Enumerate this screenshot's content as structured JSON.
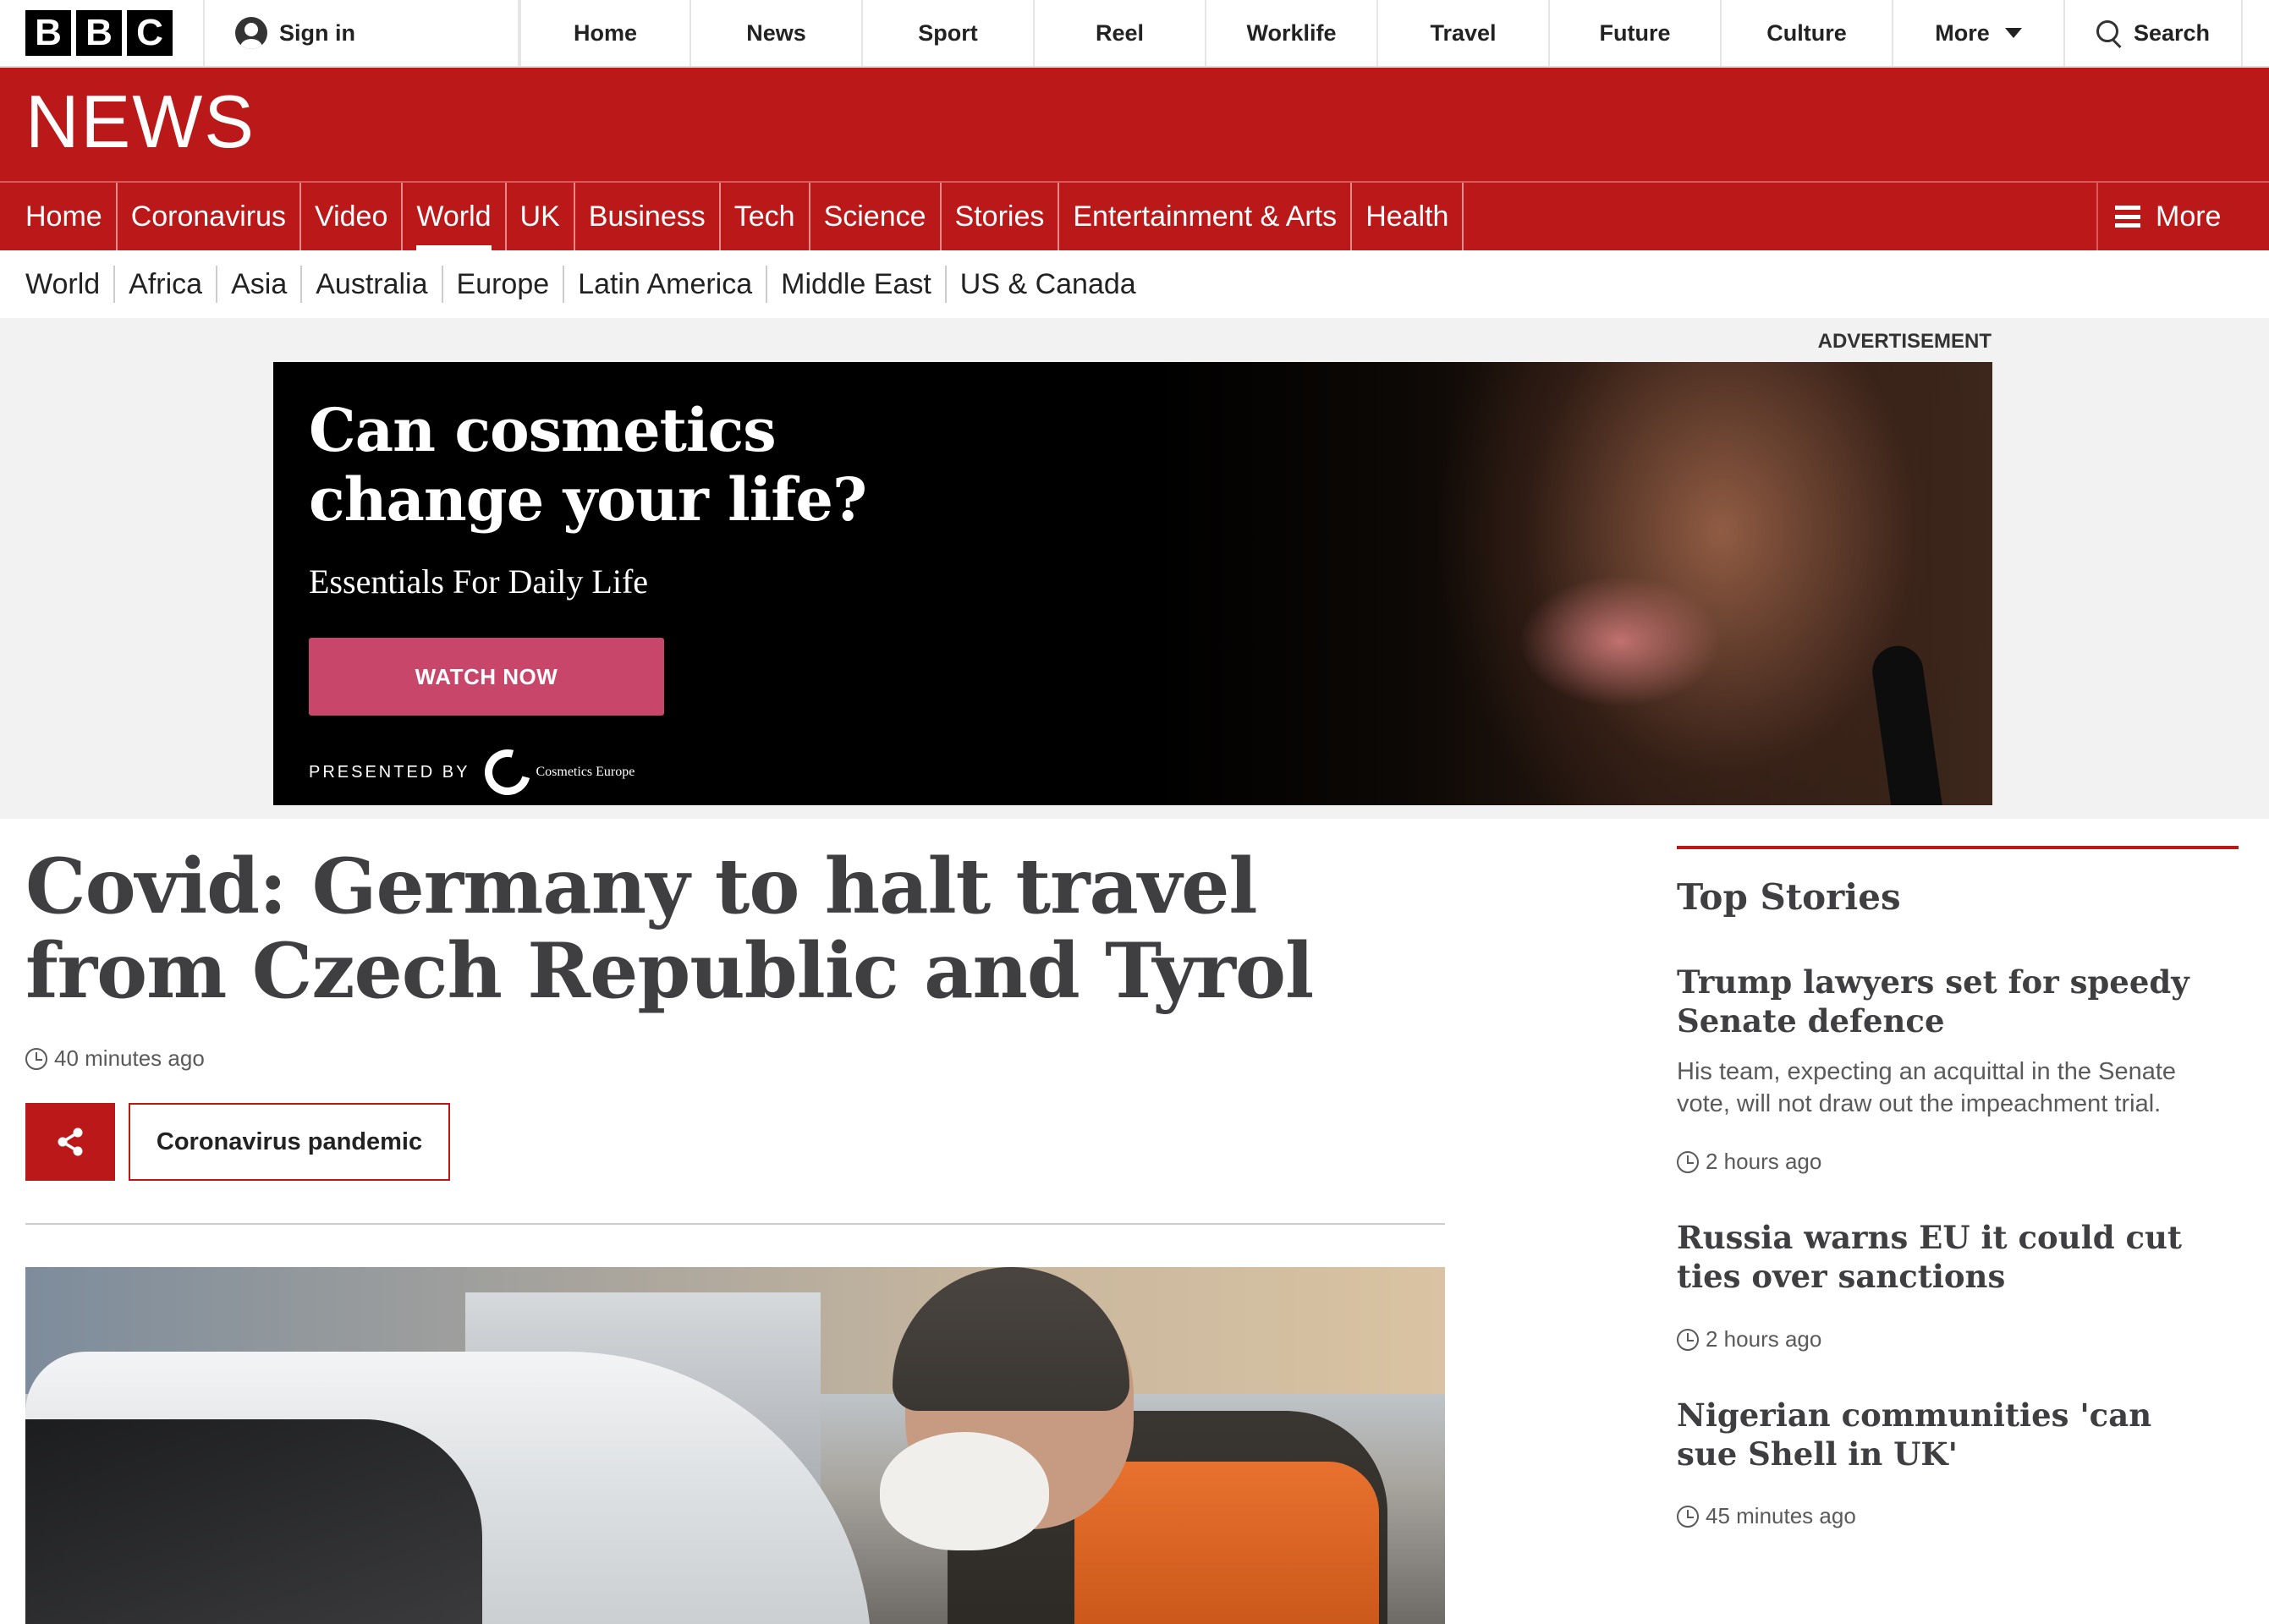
{
  "topbar": {
    "logo_letters": [
      "B",
      "B",
      "C"
    ],
    "sign_in": "Sign in",
    "nav": [
      "Home",
      "News",
      "Sport",
      "Reel",
      "Worklife",
      "Travel",
      "Future",
      "Culture"
    ],
    "more": "More",
    "search": "Search"
  },
  "masthead": {
    "title": "NEWS"
  },
  "section_nav": {
    "items": [
      "Home",
      "Coronavirus",
      "Video",
      "World",
      "UK",
      "Business",
      "Tech",
      "Science",
      "Stories",
      "Entertainment & Arts",
      "Health"
    ],
    "active": "World",
    "more": "More"
  },
  "sub_nav": {
    "items": [
      "World",
      "Africa",
      "Asia",
      "Australia",
      "Europe",
      "Latin America",
      "Middle East",
      "US & Canada"
    ],
    "active": "Europe"
  },
  "ad": {
    "label": "ADVERTISEMENT",
    "headline_line1": "Can cosmetics",
    "headline_line2": "change your life?",
    "subline": "Essentials For Daily Life",
    "cta": "WATCH NOW",
    "presented_by": "PRESENTED BY",
    "sponsor": "Cosmetics Europe",
    "cta_color": "#c9466b"
  },
  "article": {
    "title": "Covid: Germany to halt travel from Czech Republic and Tyrol",
    "timestamp": "40 minutes ago",
    "topic": "Coronavirus pandemic",
    "share_icon": "share-icon"
  },
  "sidebar": {
    "title": "Top Stories",
    "stories": [
      {
        "headline": "Trump lawyers set for speedy Senate defence",
        "summary": "His team, expecting an acquittal in the Senate vote, will not draw out the impeachment trial.",
        "time": "2 hours ago"
      },
      {
        "headline": "Russia warns EU it could cut ties over sanctions",
        "time": "2 hours ago"
      },
      {
        "headline": "Nigerian communities 'can sue Shell in UK'",
        "time": "45 minutes ago"
      }
    ]
  },
  "colors": {
    "brand_red": "#bb1919",
    "text_dark": "#3f3f42"
  }
}
